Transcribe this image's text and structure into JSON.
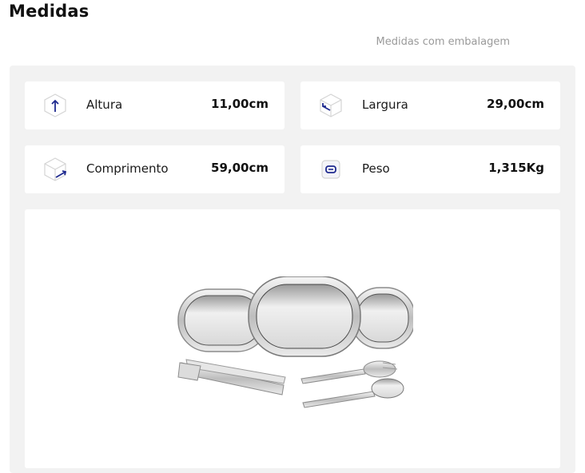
{
  "header": {
    "title": "Medidas",
    "subtitle": "Medidas com embalagem"
  },
  "measures": [
    {
      "label": "Altura",
      "value": "11,00cm",
      "icon": "height-arrow-up-icon"
    },
    {
      "label": "Largura",
      "value": "29,00cm",
      "icon": "width-box-icon"
    },
    {
      "label": "Comprimento",
      "value": "59,00cm",
      "icon": "length-box-icon"
    },
    {
      "label": "Peso",
      "value": "1,315Kg",
      "icon": "weight-scale-icon"
    }
  ],
  "colors": {
    "accent": "#1f2a8f",
    "panel_bg": "#f2f2f2",
    "card_bg": "#ffffff",
    "muted_text": "#9a9a9a"
  }
}
